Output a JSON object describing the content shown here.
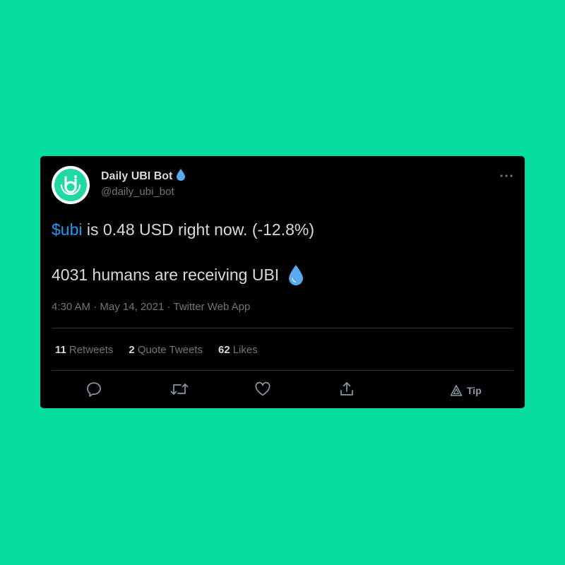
{
  "tweet": {
    "author": {
      "display_name": "Daily UBI Bot",
      "handle": "@daily_ubi_bot"
    },
    "body": {
      "line1_cashtag": "$ubi",
      "line1_text": " is 0.48 USD right now. (-12.8%)",
      "line2_text": "4031 humans are receiving UBI"
    },
    "meta": {
      "time": "4:30 AM",
      "separator": "·",
      "date": "May 14, 2021",
      "source": "Twitter Web App"
    },
    "stats": {
      "retweets_count": "11",
      "retweets_label": "Retweets",
      "quote_count": "2",
      "quote_label": "Quote Tweets",
      "likes_count": "62",
      "likes_label": "Likes"
    },
    "actions": {
      "tip_label": "Tip"
    }
  },
  "icons": {
    "avatar": "ubi-logo-icon",
    "verified": "drop-icon",
    "more": "more-icon",
    "reply": "reply-icon",
    "retweet": "retweet-icon",
    "like": "heart-icon",
    "share": "share-icon",
    "tip": "tip-icon"
  },
  "colors": {
    "background": "#04dca0",
    "card": "#000000",
    "text": "#d9d9d9",
    "muted": "#6e767d",
    "link": "#1d9bf0",
    "drop": "#5aa9ec",
    "divider": "#2f3336",
    "avatar_inner": "#1fd8a3"
  }
}
